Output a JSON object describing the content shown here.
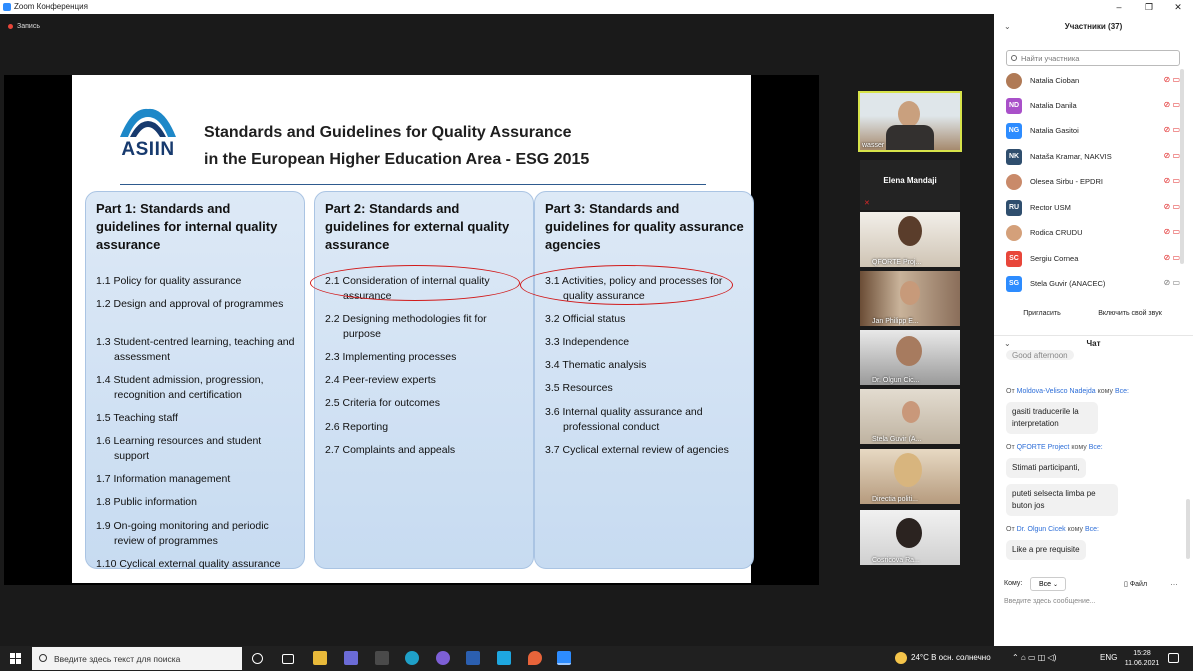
{
  "window": {
    "title": "Zoom Конференция",
    "min": "–",
    "max": "❐",
    "close": "✕"
  },
  "recording": "Запись",
  "slide": {
    "logo": "ASIIN",
    "title_line1": "Standards and Guidelines for Quality Assurance",
    "title_line2": "in the European Higher Education Area - ESG 2015",
    "columns": [
      {
        "heading": "Part 1: Standards and guidelines for internal quality assurance",
        "items": [
          "1.1 Policy for quality assurance",
          "1.2 Design and approval of programmes",
          "1.3 Student-centred learning, teaching and assessment",
          "1.4 Student admission, progression, recognition and certification",
          "1.5 Teaching staff",
          "1.6 Learning resources and student support",
          "1.7 Information management",
          "1.8 Public information",
          "1.9 On-going monitoring and periodic review of programmes",
          "1.10 Cyclical external quality assurance"
        ]
      },
      {
        "heading": "Part 2: Standards and guidelines for external quality assurance",
        "items": [
          "2.1 Consideration of internal quality assurance",
          "2.2 Designing methodologies fit for purpose",
          "2.3 Implementing processes",
          "2.4 Peer-review experts",
          "2.5 Criteria for outcomes",
          "2.6 Reporting",
          "2.7 Complaints and appeals"
        ]
      },
      {
        "heading": "Part 3: Standards and guidelines for quality assurance agencies",
        "items": [
          "3.1 Activities, policy and processes for quality assurance",
          "3.2 Official status",
          "3.3 Independence",
          "3.4 Thematic analysis",
          "3.5 Resources",
          "3.6 Internal quality assurance and professional conduct",
          "3.7 Cyclical external review of agencies"
        ]
      }
    ]
  },
  "videos": {
    "top": "wasser",
    "name_only": "Elena Mandaji",
    "tiles": [
      "QFORTE Proj...",
      "Jan Philipp E...",
      "Dr. Olgun Cic...",
      "Stela Guvir (A...",
      "Directia politi...",
      "Cosricova Ra..."
    ]
  },
  "participants": {
    "header": "Участники (37)",
    "search_placeholder": "Найти участника",
    "list": [
      {
        "initials": "",
        "name": "Natalia Cioban",
        "color": "#b07a56"
      },
      {
        "initials": "ND",
        "name": "Natalia Danila",
        "color": "#a950c9"
      },
      {
        "initials": "NG",
        "name": "Natalia Gasitoi",
        "color": "#2d8cff"
      },
      {
        "initials": "NK",
        "name": "Nataša Kramar, NAKVIS",
        "color": "#2f4e6e"
      },
      {
        "initials": "",
        "name": "Olesea Sirbu - EPDRI",
        "color": "#c98a6a"
      },
      {
        "initials": "RU",
        "name": "Rector USM",
        "color": "#2f4e6e"
      },
      {
        "initials": "",
        "name": "Rodica CRUDU",
        "color": "#d4a07a"
      },
      {
        "initials": "SC",
        "name": "Sergiu Cornea",
        "color": "#e8463a"
      },
      {
        "initials": "SG",
        "name": "Stela Guvir (ANACEC)",
        "color": "#2d8cff"
      }
    ],
    "invite": "Пригласить",
    "unmute": "Включить свой звук"
  },
  "chat": {
    "header": "Чат",
    "partial": "Good afternoon",
    "messages": [
      {
        "from": "Moldova-Velisco Nadejda",
        "to": "Все:",
        "texts": [
          "gasiti traducerile la interpretation"
        ]
      },
      {
        "from": "QFORTE Project",
        "to": "Все:",
        "texts": [
          "Stimati participanti,",
          "puteti selsecta limba pe buton jos"
        ]
      },
      {
        "from": "Dr. Olgun Cicek",
        "to": "Все:",
        "texts": [
          "Like a pre requisite"
        ]
      }
    ],
    "from_label": "От",
    "to_label": "кому",
    "recipient_label": "Кому:",
    "recipient_value": "Все",
    "file_label": "Файл",
    "input_placeholder": "Введите здесь сообщение..."
  },
  "taskbar": {
    "search": "Введите здесь текст для поиска",
    "weather": "24°C  В осн. солнечно",
    "lang": "ENG",
    "time": "15:28",
    "date": "11.06.2021"
  }
}
